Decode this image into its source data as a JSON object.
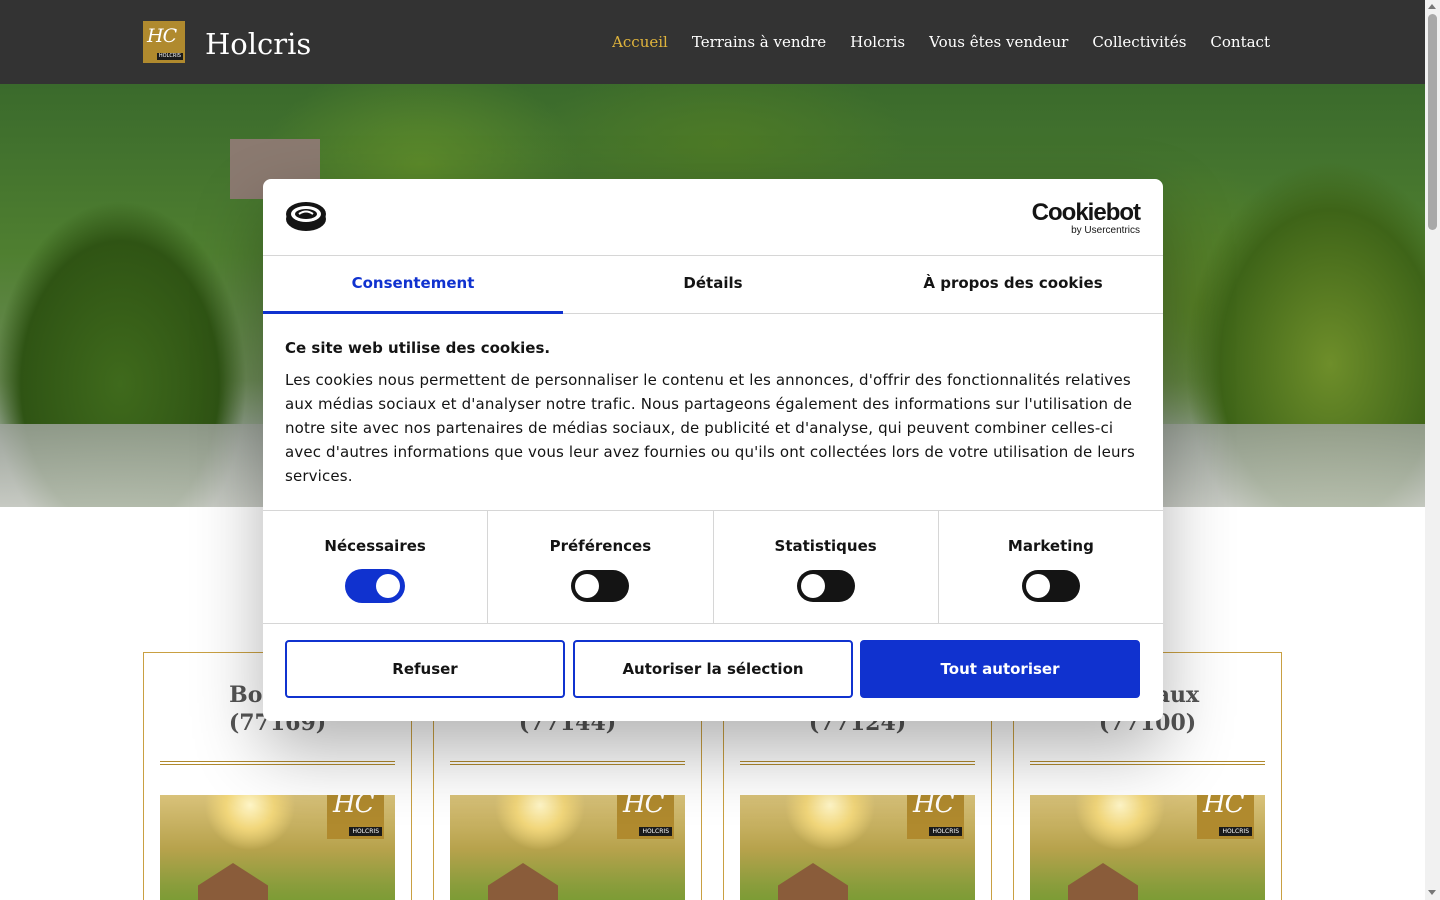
{
  "site": {
    "logo_mono": "HC",
    "logo_small": "HOLCRIS",
    "name": "Holcris"
  },
  "nav": {
    "items": [
      {
        "label": "Accueil",
        "active": true
      },
      {
        "label": "Terrains à vendre"
      },
      {
        "label": "Holcris"
      },
      {
        "label": "Vous êtes vendeur"
      },
      {
        "label": "Collectivités"
      },
      {
        "label": "Contact"
      }
    ],
    "active_color": "#e0b43c"
  },
  "cards": [
    {
      "city": "Boissy-l",
      "zip": "(77169)"
    },
    {
      "city": "",
      "zip": "(77144)"
    },
    {
      "city": "",
      "zip": "(77124)"
    },
    {
      "city": "s-Meaux",
      "zip": "(77100)"
    }
  ],
  "cookie_dialog": {
    "brand": {
      "name": "Cookiebot",
      "by": "by Usercentrics"
    },
    "tabs": [
      {
        "label": "Consentement",
        "active": true
      },
      {
        "label": "Détails"
      },
      {
        "label": "À propos des cookies"
      }
    ],
    "title": "Ce site web utilise des cookies.",
    "text": "Les cookies nous permettent de personnaliser le contenu et les annonces, d'offrir des fonctionnalités relatives aux médias sociaux et d'analyser notre trafic. Nous partageons également des informations sur l'utilisation de notre site avec nos partenaires de médias sociaux, de publicité et d'analyse, qui peuvent combiner celles-ci avec d'autres informations que vous leur avez fournies ou qu'ils ont collectées lors de votre utilisation de leurs services.",
    "toggles": [
      {
        "label": "Nécessaires",
        "on": true
      },
      {
        "label": "Préférences",
        "on": false
      },
      {
        "label": "Statistiques",
        "on": false
      },
      {
        "label": "Marketing",
        "on": false
      }
    ],
    "buttons": {
      "refuse": "Refuser",
      "allow_selection": "Autoriser la sélection",
      "allow_all": "Tout autoriser"
    },
    "accent_color": "#1032cf"
  },
  "colors": {
    "header_bg": "#333333",
    "gold": "#b08a2e"
  }
}
